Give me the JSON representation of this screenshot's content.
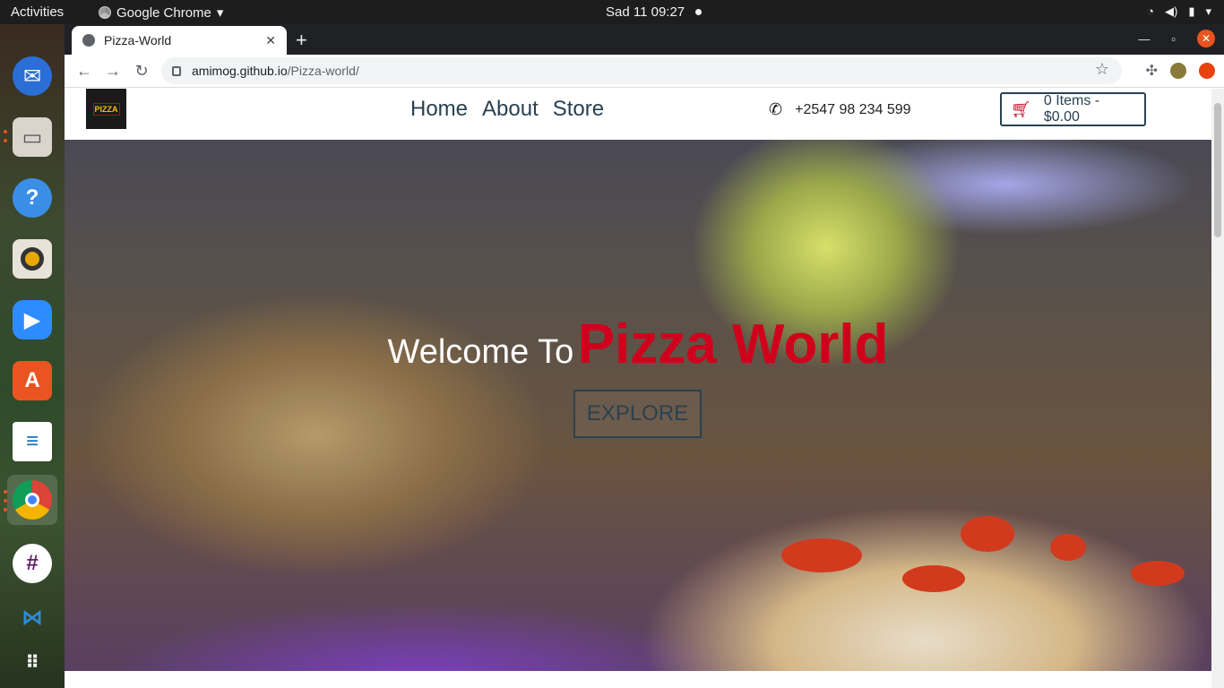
{
  "system": {
    "activities": "Activities",
    "app_name": "Google Chrome",
    "clock": "Sad 11  09:27"
  },
  "browser": {
    "tab_title": "Pizza-World",
    "url_host": "amimog.github.io",
    "url_path": "/Pizza-world/"
  },
  "site": {
    "nav": [
      "Home",
      "About",
      "Store"
    ],
    "phone": "+2547 98 234 599",
    "cart": "0 Items - $0.00",
    "logo_text": "PIZZA",
    "hero": {
      "welcome": "Welcome To",
      "brand": "Pizza World",
      "cta": "EXPLORE"
    }
  },
  "colors": {
    "brand_red": "#d0001c",
    "nav_text": "#2a4151",
    "ubuntu_orange": "#e95420"
  },
  "dock": [
    "firefox-icon",
    "thunderbird-icon",
    "files-icon",
    "help-icon",
    "rhythmbox-icon",
    "zoom-icon",
    "software-icon",
    "writer-icon",
    "chrome-icon",
    "slack-icon",
    "vscode-icon",
    "app-grid-icon"
  ]
}
